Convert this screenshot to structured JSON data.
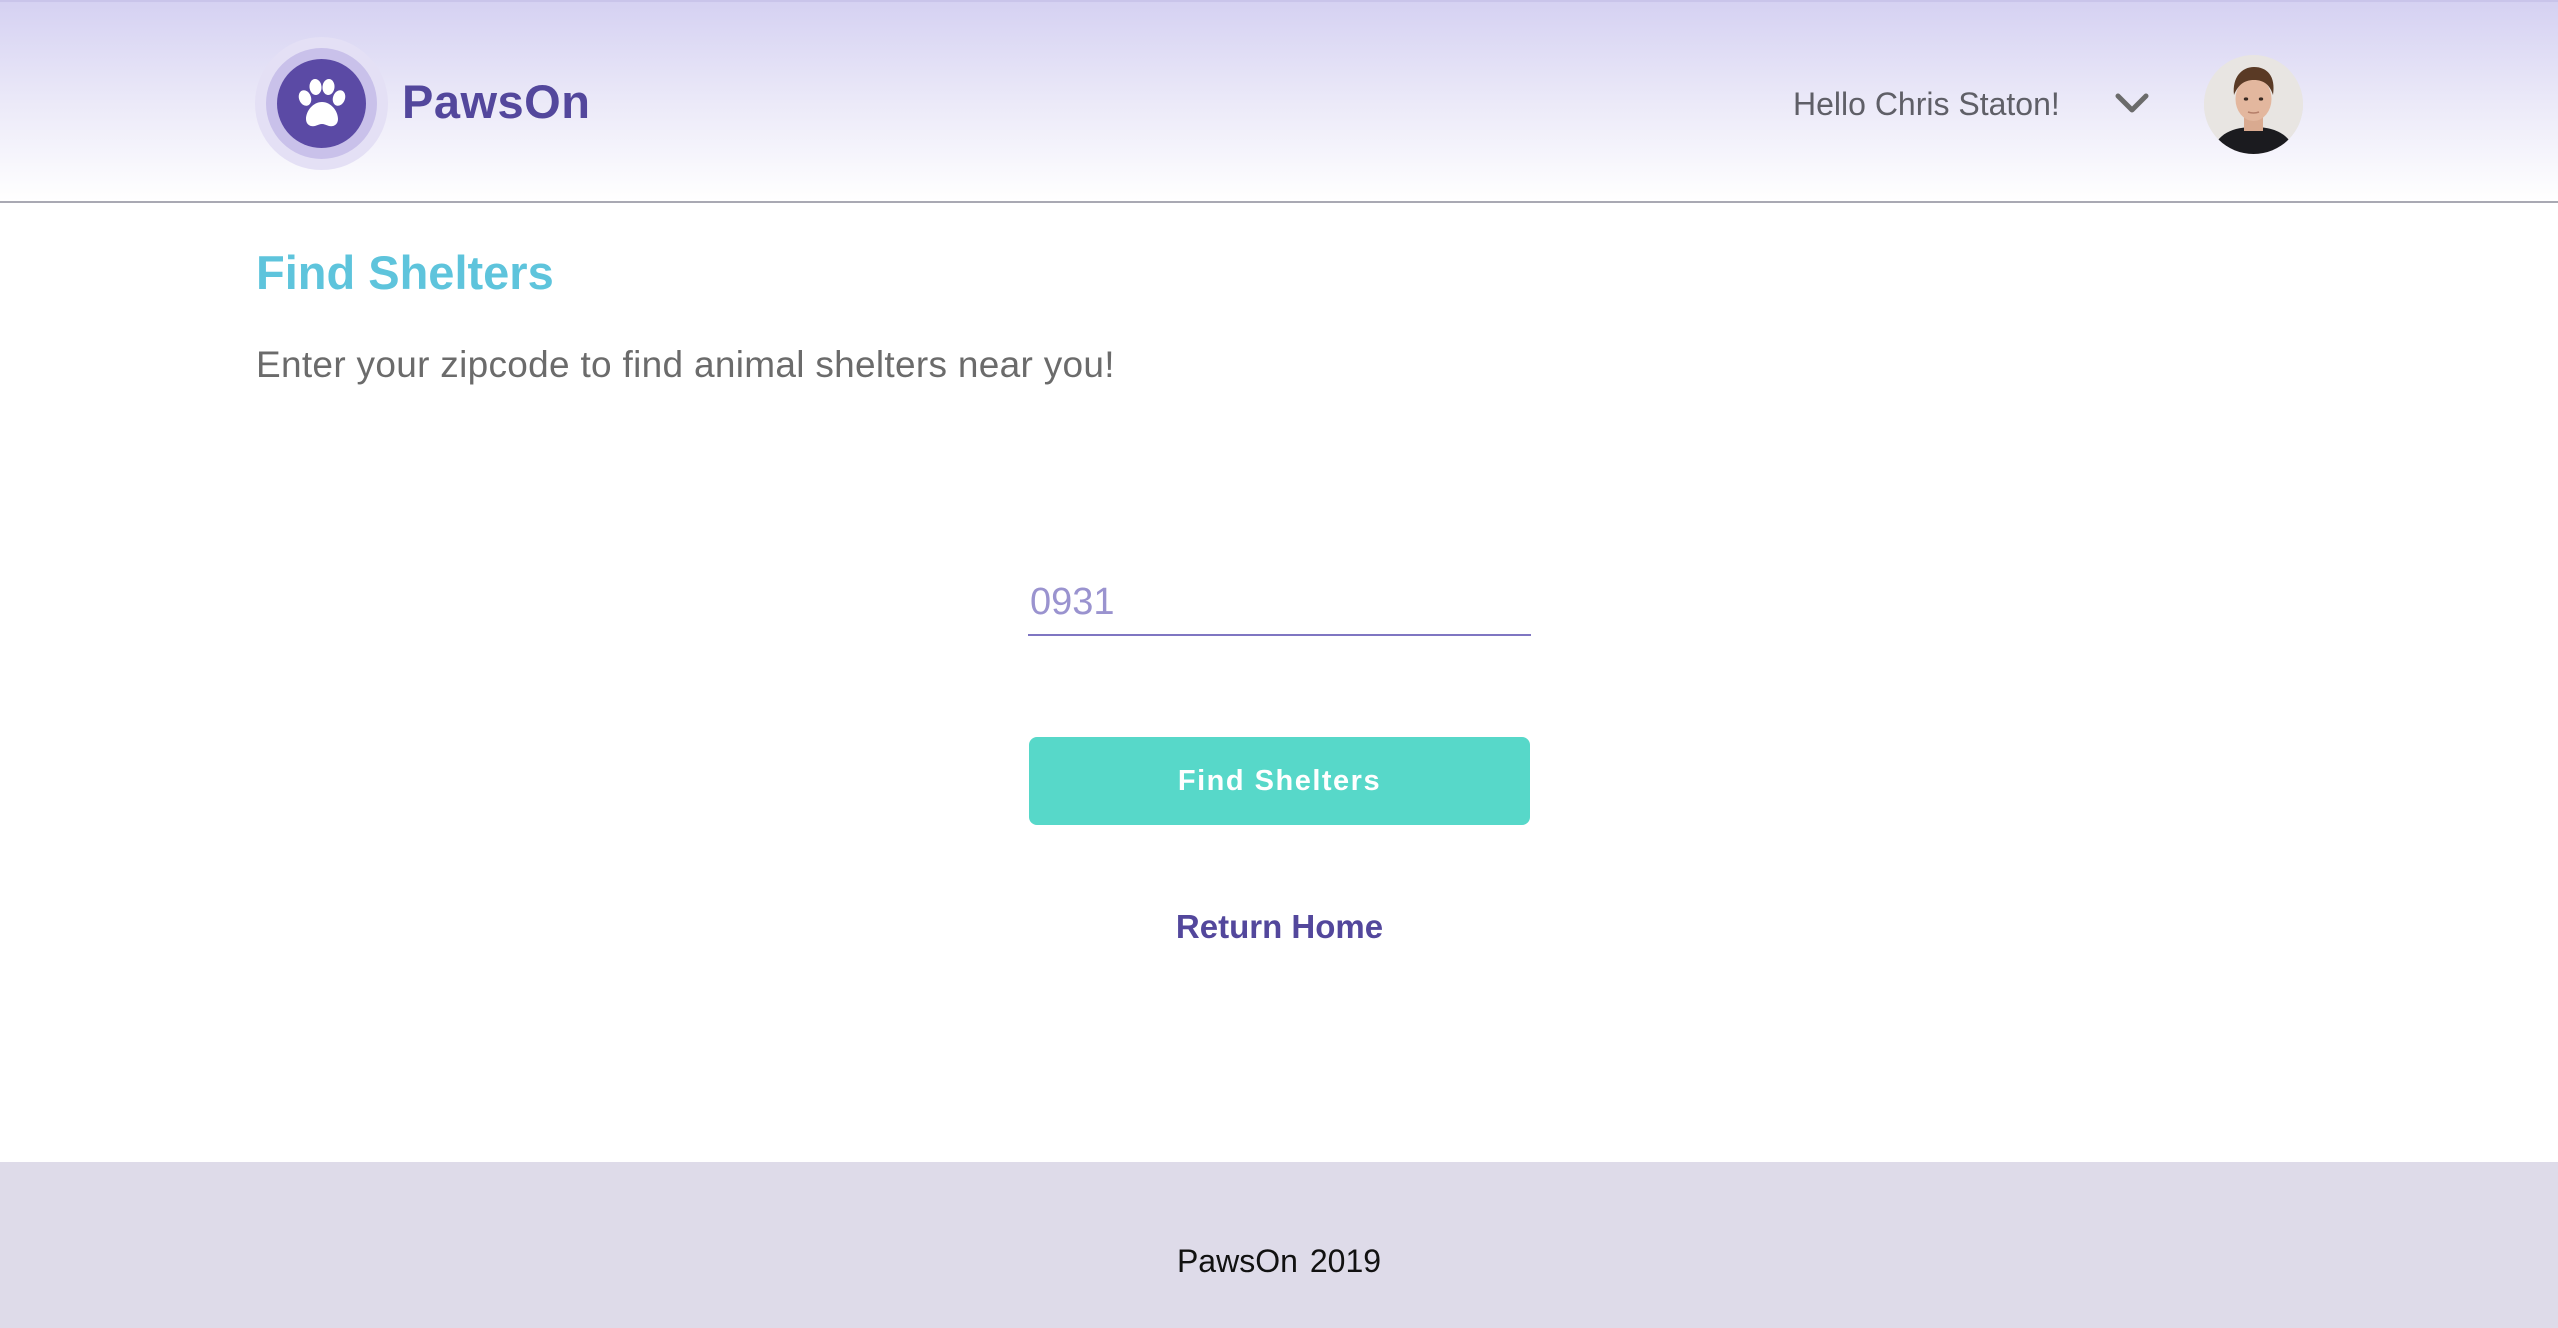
{
  "header": {
    "brand_name": "PawsOn",
    "logo_icon": "paw-icon",
    "greeting": "Hello Chris Staton!",
    "menu_icon": "chevron-down-icon",
    "avatar_icon": "user-avatar"
  },
  "main": {
    "title": "Find Shelters",
    "subtitle": "Enter your zipcode to find animal shelters near you!",
    "zip_input": {
      "value": "0931",
      "placeholder": ""
    },
    "find_button_label": "Find Shelters",
    "return_link_label": "Return Home"
  },
  "footer": {
    "brand": "PawsOn",
    "year": "2019"
  },
  "colors": {
    "brand_purple": "#53479c",
    "title_blue": "#5ec4dc",
    "button_teal": "#57d8c9",
    "footer_bg": "#dedbe9"
  }
}
